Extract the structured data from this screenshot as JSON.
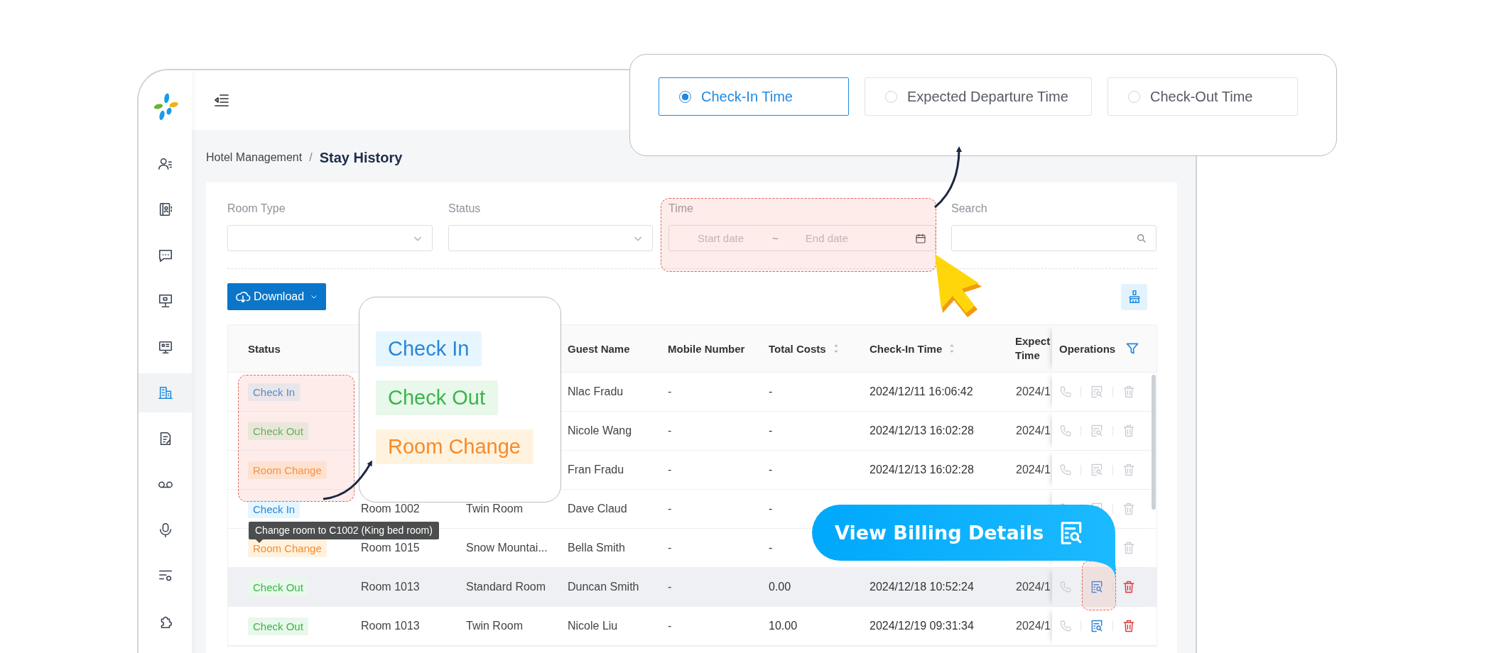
{
  "sidebar": {
    "items": [
      {
        "selected": false
      },
      {
        "selected": false
      },
      {
        "selected": false
      },
      {
        "selected": false
      },
      {
        "selected": false
      },
      {
        "selected": true
      },
      {
        "selected": false
      },
      {
        "selected": false
      },
      {
        "selected": false
      },
      {
        "selected": false
      },
      {
        "selected": false
      }
    ]
  },
  "breadcrumb": {
    "parent": "Hotel Management",
    "separator": "/",
    "current": "Stay History"
  },
  "filters": [
    {
      "kind": "select",
      "label": "Room Type"
    },
    {
      "kind": "select",
      "label": "Status"
    },
    {
      "kind": "date_range",
      "label": "Time",
      "start_placeholder": "Start date",
      "separator": "~",
      "end_placeholder": "End date"
    },
    {
      "kind": "search",
      "label": "Search"
    }
  ],
  "toolbar": {
    "download_button": "Download"
  },
  "table": {
    "columns": [
      {
        "label": "Status",
        "kind": "plain"
      },
      {
        "kind": "plain"
      },
      {
        "kind": "plain"
      },
      {
        "label": "Guest Name",
        "kind": "plain"
      },
      {
        "label": "Mobile Number",
        "kind": "plain"
      },
      {
        "label": "Total Costs",
        "kind": "sortable"
      },
      {
        "label": "Check-In Time",
        "kind": "sortable"
      },
      {
        "label": "Expect Time",
        "kind": "plain"
      },
      {
        "label": "Operations",
        "kind": "operations"
      }
    ],
    "rows": [
      {
        "status": {
          "kind": "check_in",
          "label": "Check In"
        },
        "guest_name": "Nlac Fradu",
        "mobile": "-",
        "total_costs": "-",
        "check_in_time": "2024/12/11 16:06:42",
        "expected_time": "2024/1",
        "hovered": false,
        "actions_enabled": false
      },
      {
        "status": {
          "kind": "check_out",
          "label": "Check Out"
        },
        "guest_name": "Nicole Wang",
        "mobile": "-",
        "total_costs": "-",
        "check_in_time": "2024/12/13 16:02:28",
        "expected_time": "2024/1",
        "hovered": false,
        "actions_enabled": false
      },
      {
        "status": {
          "kind": "room_change",
          "label": "Room Change"
        },
        "guest_name": "Fran Fradu",
        "mobile": "-",
        "total_costs": "-",
        "check_in_time": "2024/12/13 16:02:28",
        "expected_time": "2024/1",
        "hovered": false,
        "actions_enabled": false
      },
      {
        "status": {
          "kind": "check_in",
          "label": "Check In"
        },
        "room": "Room 1002",
        "room_type": "Twin Room",
        "guest_name": "Dave Claud",
        "mobile": "-",
        "total_costs": "-",
        "hovered": false,
        "actions_enabled": false
      },
      {
        "status": {
          "kind": "room_change",
          "label": "Room Change",
          "tooltip": "Change room to C1002 (King bed room)"
        },
        "room": "Room 1015",
        "room_type": "Snow Mountai...",
        "guest_name": "Bella Smith",
        "mobile": "-",
        "total_costs": "-",
        "hovered": false,
        "actions_enabled": false
      },
      {
        "status": {
          "kind": "check_out",
          "label": "Check Out"
        },
        "room": "Room 1013",
        "room_type": "Standard Room",
        "guest_name": "Duncan Smith",
        "mobile": "-",
        "total_costs": "0.00",
        "check_in_time": "2024/12/18 10:52:24",
        "expected_time": "2024/1",
        "hovered": true,
        "actions_enabled": true
      },
      {
        "status": {
          "kind": "check_out",
          "label": "Check Out"
        },
        "room": "Room 1013",
        "room_type": "Twin Room",
        "guest_name": "Nicole Liu",
        "mobile": "-",
        "total_costs": "10.00",
        "check_in_time": "2024/12/19 09:31:34",
        "expected_time": "2024/1",
        "hovered": false,
        "actions_enabled": true
      }
    ]
  },
  "time_type_popup": {
    "options": [
      {
        "label": "Check-In Time",
        "selected": true
      },
      {
        "label": "Expected Departure Time",
        "selected": false
      },
      {
        "label": "Check-Out Time",
        "selected": false
      }
    ]
  },
  "status_legend": {
    "tags": [
      {
        "kind": "check_in",
        "label": "Check In"
      },
      {
        "kind": "check_out",
        "label": "Check Out"
      },
      {
        "kind": "room_change",
        "label": "Room Change"
      }
    ]
  },
  "billing_callout": {
    "text": "View Billing Details"
  }
}
